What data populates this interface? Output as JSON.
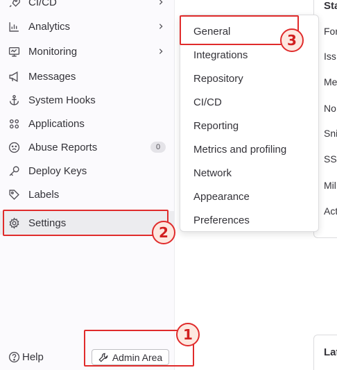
{
  "sidebar": {
    "items": [
      {
        "label": "CI/CD",
        "icon": "rocket-icon",
        "has_chevron": true
      },
      {
        "label": "Analytics",
        "icon": "chart-icon",
        "has_chevron": true
      },
      {
        "label": "Monitoring",
        "icon": "monitor-icon",
        "has_chevron": true
      },
      {
        "label": "Messages",
        "icon": "megaphone-icon"
      },
      {
        "label": "System Hooks",
        "icon": "anchor-icon"
      },
      {
        "label": "Applications",
        "icon": "grid-icon"
      },
      {
        "label": "Abuse Reports",
        "icon": "frown-icon",
        "badge": "0"
      },
      {
        "label": "Deploy Keys",
        "icon": "key-icon"
      },
      {
        "label": "Labels",
        "icon": "tag-icon"
      },
      {
        "label": "Settings",
        "icon": "gear-icon",
        "active": true
      }
    ],
    "help_label": "Help",
    "admin_area_label": "Admin Area"
  },
  "settings_menu": {
    "items": [
      "General",
      "Integrations",
      "Repository",
      "CI/CD",
      "Reporting",
      "Metrics and profiling",
      "Network",
      "Appearance",
      "Preferences"
    ]
  },
  "content": {
    "card_title": "Sta",
    "rows": [
      "For",
      "Iss",
      "Me",
      "No",
      "Sni",
      "SSI",
      "Mil",
      "Act"
    ],
    "card2_title": "Lat"
  },
  "annotations": {
    "markers": [
      "1",
      "2",
      "3"
    ],
    "color": "#e02b2b"
  }
}
